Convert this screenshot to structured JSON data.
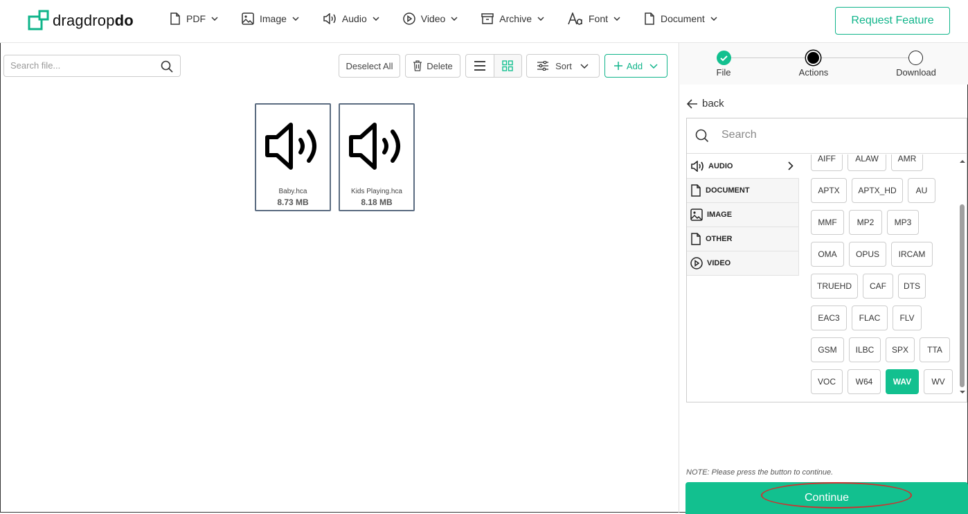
{
  "header": {
    "logo_text_1": "dragdrop",
    "logo_text_2": "do",
    "nav": [
      {
        "label": "PDF",
        "icon": "file-icon"
      },
      {
        "label": "Image",
        "icon": "image-icon"
      },
      {
        "label": "Audio",
        "icon": "audio-icon"
      },
      {
        "label": "Video",
        "icon": "play-icon"
      },
      {
        "label": "Archive",
        "icon": "archive-icon"
      },
      {
        "label": "Font",
        "icon": "font-icon"
      },
      {
        "label": "Document",
        "icon": "document-icon"
      }
    ],
    "request_feature": "Request Feature"
  },
  "toolbar": {
    "search_placeholder": "Search file...",
    "deselect_all": "Deselect All",
    "delete": "Delete",
    "sort": "Sort",
    "add": "Add"
  },
  "files": [
    {
      "name": "Baby.hca",
      "size": "8.73 MB"
    },
    {
      "name": "Kids Playing.hca",
      "size": "8.18 MB"
    }
  ],
  "steps": [
    {
      "label": "File",
      "state": "done"
    },
    {
      "label": "Actions",
      "state": "current"
    },
    {
      "label": "Download",
      "state": "pending"
    }
  ],
  "panel": {
    "back": "back",
    "search_placeholder": "Search",
    "categories": [
      "AUDIO",
      "DOCUMENT",
      "IMAGE",
      "OTHER",
      "VIDEO"
    ],
    "formats": [
      [
        "AIFF",
        "ALAW",
        "AMR"
      ],
      [
        "APTX",
        "APTX_HD",
        "AU"
      ],
      [
        "MMF",
        "MP2",
        "MP3"
      ],
      [
        "OMA",
        "OPUS",
        "IRCAM"
      ],
      [
        "TRUEHD",
        "CAF",
        "DTS"
      ],
      [
        "EAC3",
        "FLAC",
        "FLV"
      ],
      [
        "GSM",
        "ILBC",
        "SPX",
        "TTA"
      ],
      [
        "VOC",
        "W64",
        "WAV",
        "WV"
      ]
    ],
    "selected_format": "WAV",
    "note": "NOTE: Please press the button to continue.",
    "continue": "Continue"
  },
  "colors": {
    "brand": "#12c08f",
    "card_border": "#5a6b80",
    "annotation": "#d0302f"
  }
}
